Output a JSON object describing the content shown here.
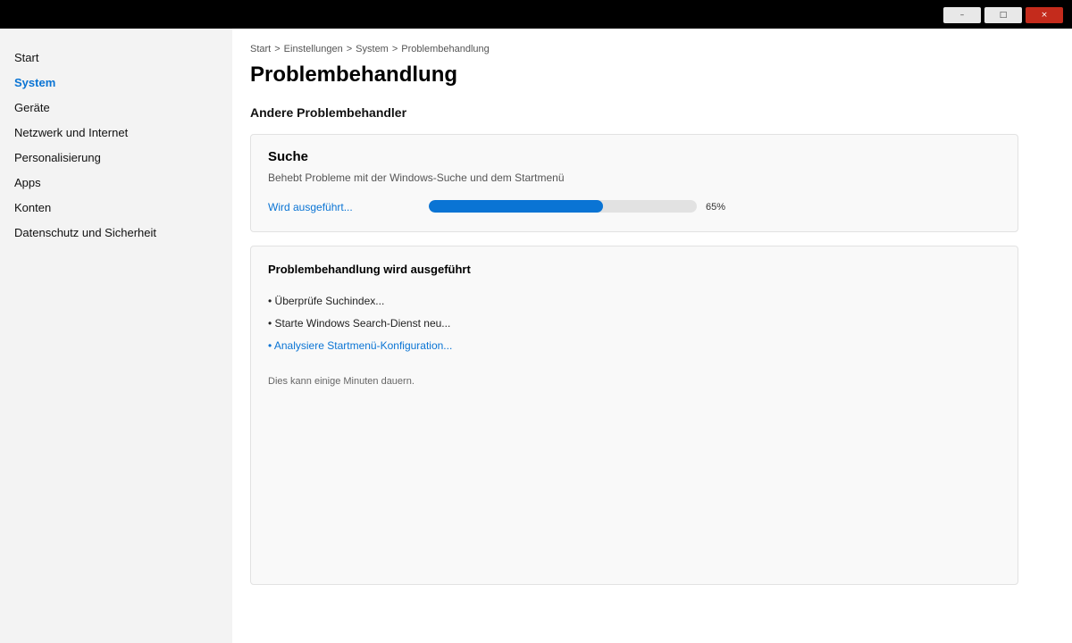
{
  "window": {
    "minimize_label": "–",
    "maximize_label": "□",
    "close_label": "×",
    "close_color": "#c42b1c"
  },
  "sidebar": {
    "items": [
      {
        "label": "Start",
        "active": false
      },
      {
        "label": "System",
        "active": true
      },
      {
        "label": "Geräte",
        "active": false
      },
      {
        "label": "Netzwerk und Internet",
        "active": false
      },
      {
        "label": "Personalisierung",
        "active": false
      },
      {
        "label": "Apps",
        "active": false
      },
      {
        "label": "Konten",
        "active": false
      },
      {
        "label": "Datenschutz und Sicherheit",
        "active": false
      }
    ]
  },
  "breadcrumb": {
    "items": [
      "Start",
      "Einstellungen",
      "System",
      "Problembehandlung"
    ],
    "separator": ">"
  },
  "page": {
    "title": "Problembehandlung",
    "section_title": "Andere Problembehandler"
  },
  "troubleshooter": {
    "title": "Suche",
    "description": "Behebt Probleme mit der Windows-Suche und dem Startmenü",
    "status": "Wird ausgeführt...",
    "progress_percent": 65,
    "progress_label": "65%"
  },
  "details": {
    "title": "Problembehandlung wird ausgeführt",
    "steps": [
      {
        "text": "• Überprüfe Suchindex...",
        "current": false
      },
      {
        "text": "• Starte Windows Search-Dienst neu...",
        "current": false
      },
      {
        "text": "• Analysiere Startmenü-Konfiguration...",
        "current": true
      }
    ],
    "note": "Dies kann einige Minuten dauern."
  },
  "colors": {
    "accent": "#0a74d4",
    "sidebar_bg": "#f3f3f3",
    "card_bg": "#f9f9f9",
    "titlebar_bg": "#000000"
  }
}
